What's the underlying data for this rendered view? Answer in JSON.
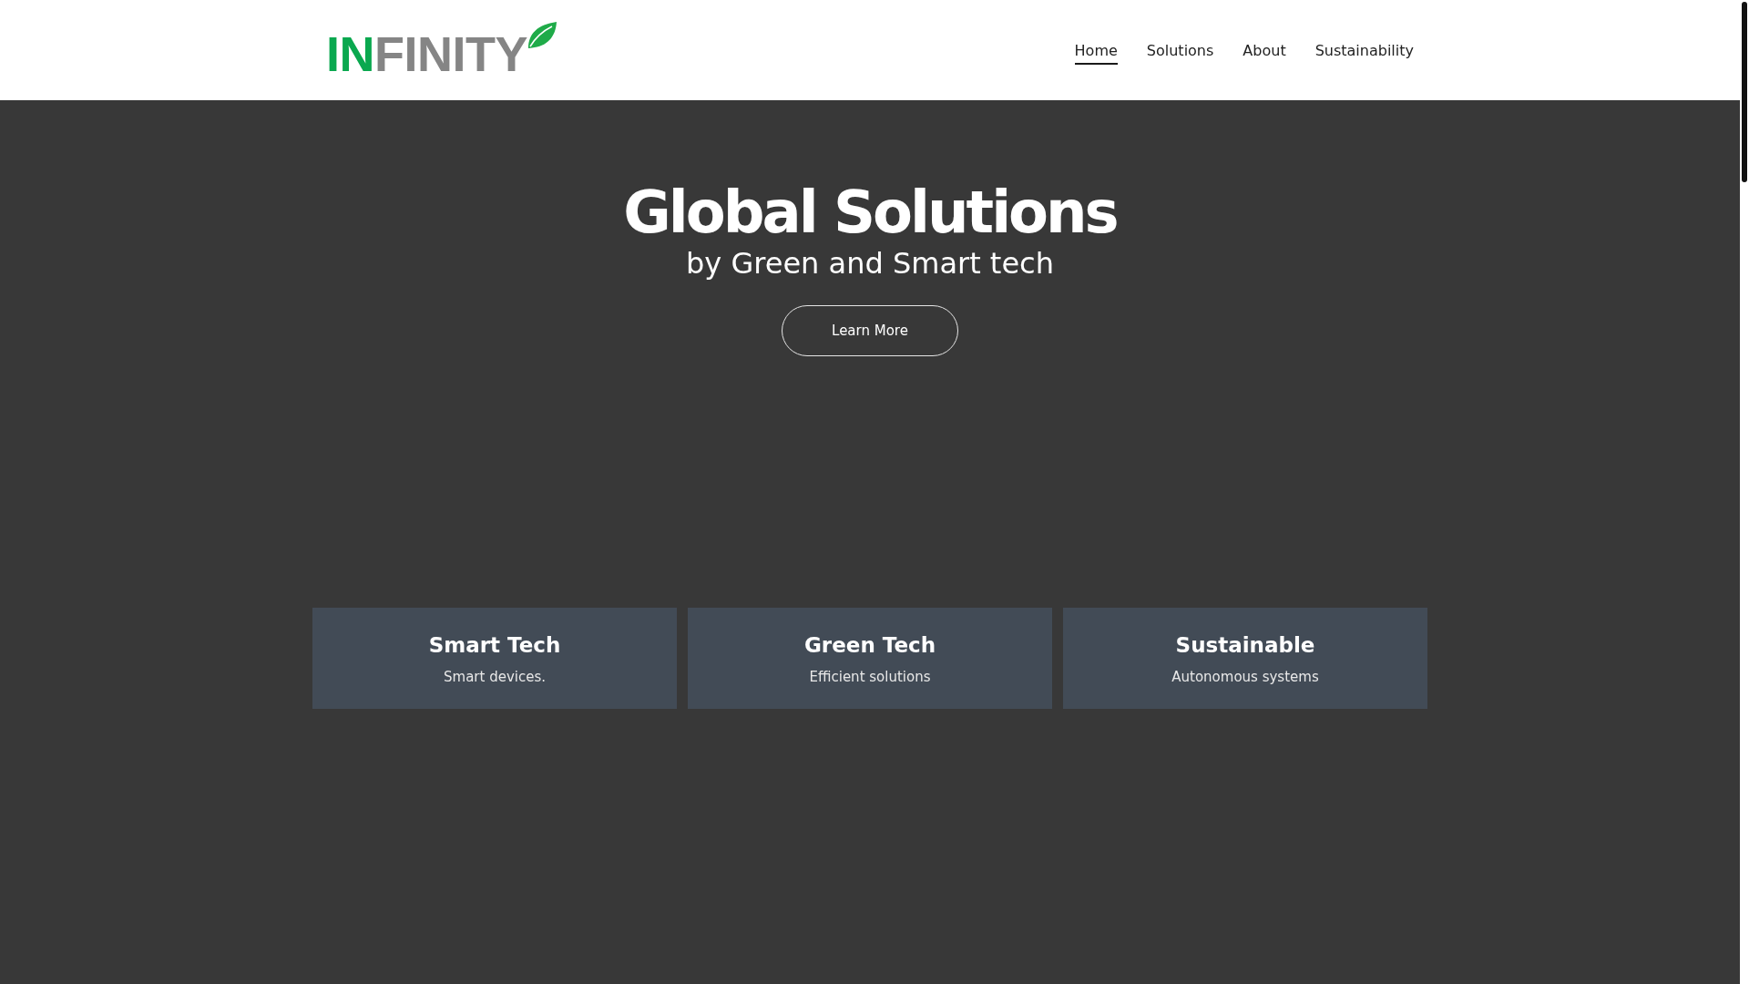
{
  "header": {
    "logo": {
      "parts": [
        {
          "text": "IN",
          "color": "#0aa84f"
        },
        {
          "text": "FINITY",
          "color": "#858585"
        }
      ]
    },
    "nav": [
      {
        "label": "Home",
        "selected": true
      },
      {
        "label": "Solutions",
        "selected": false
      },
      {
        "label": "About",
        "selected": false
      },
      {
        "label": "Sustainability",
        "selected": false
      }
    ]
  },
  "hero": {
    "title": "Global Solutions",
    "subtitle": "by Green and Smart tech",
    "button": "Learn More"
  },
  "cards": [
    {
      "title": "Smart Tech",
      "description": "Smart devices."
    },
    {
      "title": "Green Tech",
      "description": "Efficient solutions"
    },
    {
      "title": "Sustainable",
      "description": "Autonomous systems"
    }
  ]
}
